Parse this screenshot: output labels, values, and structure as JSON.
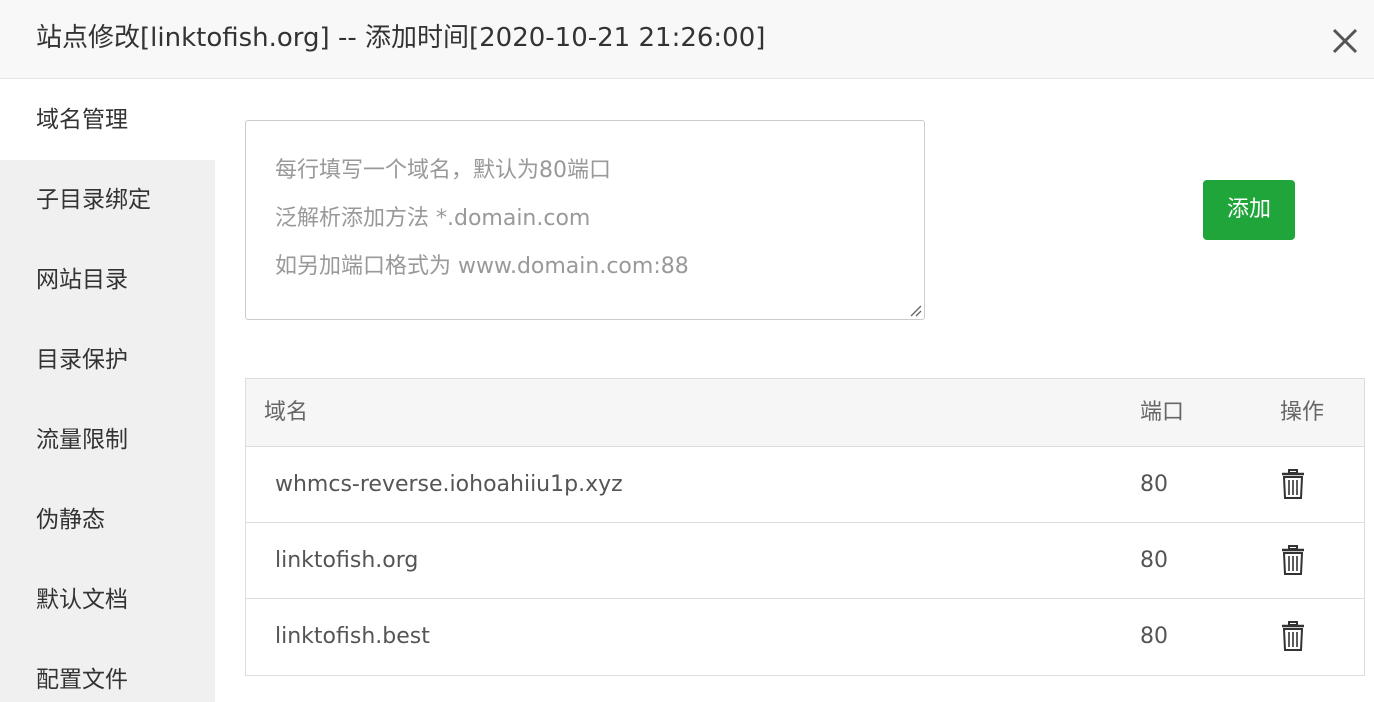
{
  "dialog": {
    "title": "站点修改[linktofish.org] -- 添加时间[2020-10-21 21:26:00]",
    "close_icon": "close-icon"
  },
  "sidebar": {
    "items": [
      {
        "label": "域名管理",
        "active": true
      },
      {
        "label": "子目录绑定",
        "active": false
      },
      {
        "label": "网站目录",
        "active": false
      },
      {
        "label": "目录保护",
        "active": false
      },
      {
        "label": "流量限制",
        "active": false
      },
      {
        "label": "伪静态",
        "active": false
      },
      {
        "label": "默认文档",
        "active": false
      },
      {
        "label": "配置文件",
        "active": false
      }
    ]
  },
  "domain_input": {
    "value": "",
    "placeholder_lines": [
      "每行填写一个域名，默认为80端口",
      "泛解析添加方法 *.domain.com",
      "如另加端口格式为 www.domain.com:88"
    ]
  },
  "add_button": {
    "label": "添加",
    "color": "#20a53a"
  },
  "table": {
    "headers": {
      "domain": "域名",
      "port": "端口",
      "action": "操作"
    },
    "rows": [
      {
        "domain": "whmcs-reverse.iohoahiiu1p.xyz",
        "port": "80",
        "action_icon": "trash-icon"
      },
      {
        "domain": "linktofish.org",
        "port": "80",
        "action_icon": "trash-icon"
      },
      {
        "domain": "linktofish.best",
        "port": "80",
        "action_icon": "trash-icon"
      }
    ]
  }
}
